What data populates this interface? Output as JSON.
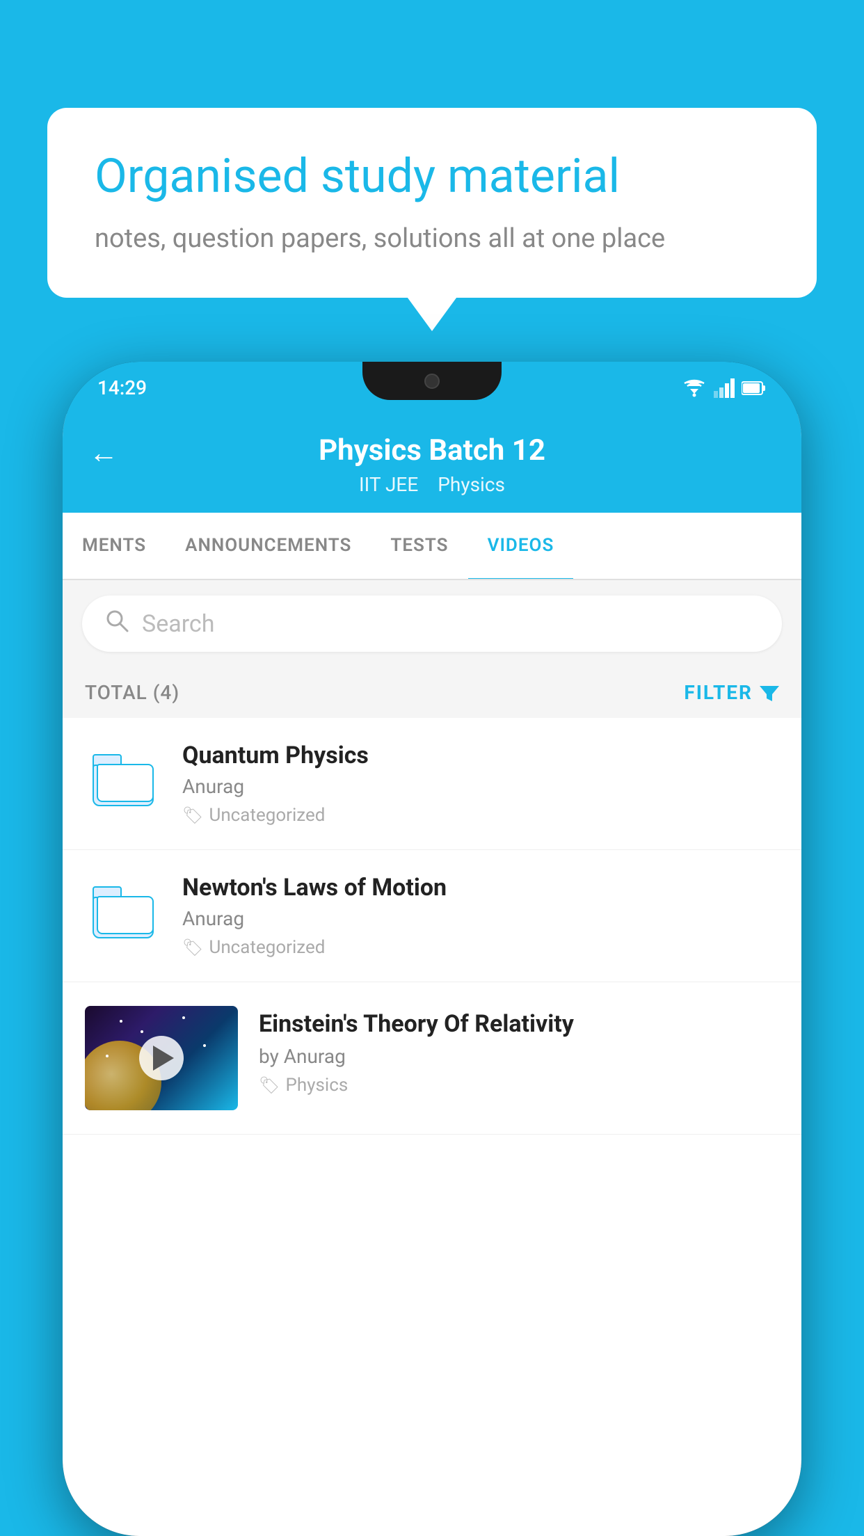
{
  "background_color": "#1ab8e8",
  "speech_bubble": {
    "title": "Organised study material",
    "subtitle": "notes, question papers, solutions all at one place"
  },
  "phone": {
    "status_bar": {
      "time": "14:29"
    },
    "header": {
      "title": "Physics Batch 12",
      "subtitle_left": "IIT JEE",
      "subtitle_right": "Physics",
      "back_label": "←"
    },
    "tabs": [
      {
        "label": "MENTS",
        "active": false
      },
      {
        "label": "ANNOUNCEMENTS",
        "active": false
      },
      {
        "label": "TESTS",
        "active": false
      },
      {
        "label": "VIDEOS",
        "active": true
      }
    ],
    "search": {
      "placeholder": "Search"
    },
    "filter_row": {
      "total_label": "TOTAL (4)",
      "filter_label": "FILTER"
    },
    "videos": [
      {
        "title": "Quantum Physics",
        "author": "Anurag",
        "tag": "Uncategorized",
        "type": "folder"
      },
      {
        "title": "Newton's Laws of Motion",
        "author": "Anurag",
        "tag": "Uncategorized",
        "type": "folder"
      },
      {
        "title": "Einstein's Theory Of Relativity",
        "author": "by Anurag",
        "tag": "Physics",
        "type": "thumbnail"
      }
    ]
  }
}
